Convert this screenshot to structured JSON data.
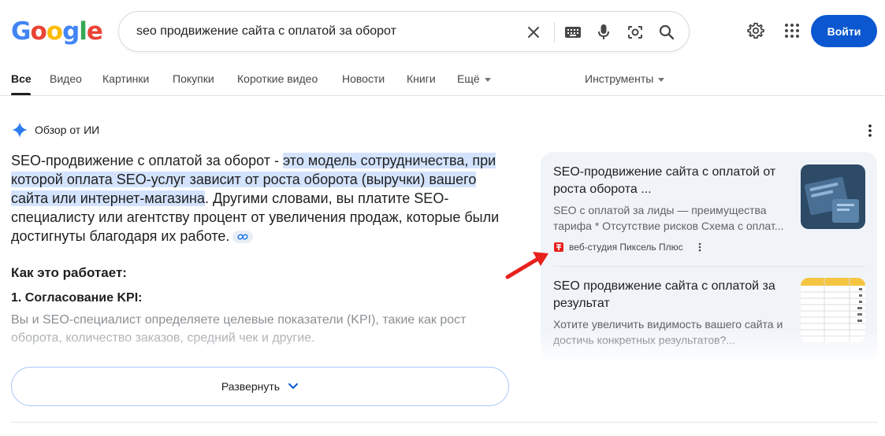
{
  "header": {
    "logo_letters": [
      {
        "ch": "G",
        "color": "#4285f4"
      },
      {
        "ch": "o",
        "color": "#ea4335"
      },
      {
        "ch": "o",
        "color": "#fbbc05"
      },
      {
        "ch": "g",
        "color": "#4285f4"
      },
      {
        "ch": "l",
        "color": "#34a853"
      },
      {
        "ch": "e",
        "color": "#ea4335"
      }
    ],
    "query": "seo продвижение сайта с оплатой за оборот",
    "login_label": "Войти",
    "icons": {
      "clear": "close-icon",
      "keyboard": "keyboard-icon",
      "voice": "microphone-icon",
      "lens": "camera-lens-icon",
      "search": "search-icon",
      "settings": "gear-icon",
      "apps": "apps-grid-icon"
    }
  },
  "tabs": [
    {
      "label": "Все",
      "active": true
    },
    {
      "label": "Видео"
    },
    {
      "label": "Картинки"
    },
    {
      "label": "Покупки"
    },
    {
      "label": "Короткие видео"
    },
    {
      "label": "Новости"
    },
    {
      "label": "Книги"
    },
    {
      "label": "Ещё"
    }
  ],
  "tools_label": "Инструменты",
  "ai_overview": {
    "title": "Обзор от ИИ",
    "text_before": "SEO-продвижение с оплатой за оборот - ",
    "text_highlight": "это модель сотрудничества, при которой оплата SEO-услуг зависит от роста оборота (выручки) вашего сайта или интернет-магазина",
    "text_after": ". Другими словами, вы платите SEO-специалисту или агентству процент от увеличения продаж, которые были достигнуты благодаря их работе.",
    "how_title": "Как это работает:",
    "step1_title": "1. Согласование KPI:",
    "step1_text": "Вы и SEO-специалист определяете целевые показатели (KPI), такие как рост оборота, количество заказов, средний чек и другие.",
    "expand_label": "Развернуть"
  },
  "sources": [
    {
      "title": "SEO-продвижение сайта с оплатой от роста оборота ...",
      "snippet": "SEO с оплатой за лиды — преимущества тарифа * Отсутствие рисков Схема с оплат...",
      "site": "веб-студия Пиксель Плюс"
    },
    {
      "title": "SEO продвижение сайта с оплатой за результат",
      "snippet": "Хотите увеличить видимость вашего сайта и достичь конкретных результатов?..."
    }
  ],
  "colors": {
    "accent": "#0b57d0",
    "highlight": "#d3e3fd",
    "panel": "#f0f4f9",
    "arrow": "#e8211e"
  }
}
